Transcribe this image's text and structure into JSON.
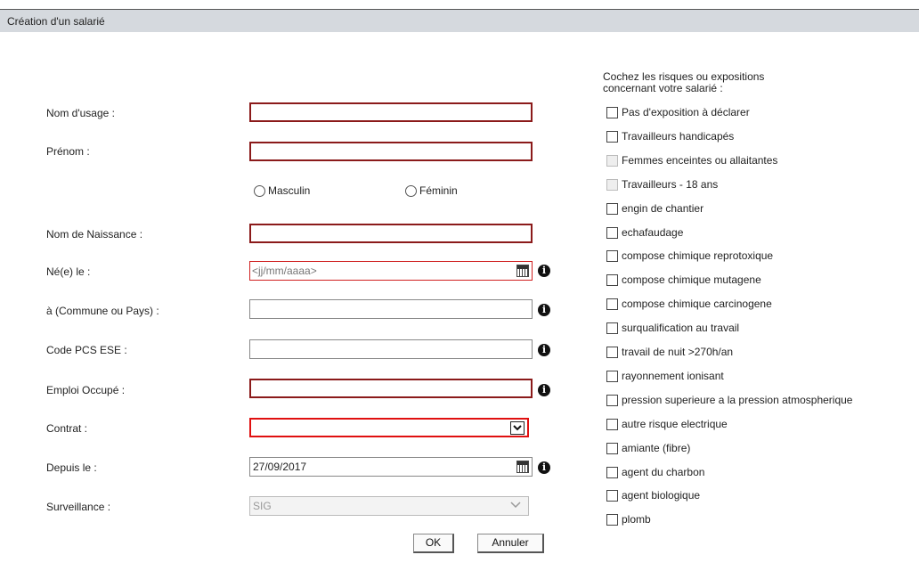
{
  "window": {
    "title": "Création d'un salarié"
  },
  "form": {
    "nom_usage": {
      "label": "Nom d'usage :",
      "value": ""
    },
    "prenom": {
      "label": "Prénom :",
      "value": ""
    },
    "sexe": {
      "options": [
        "Masculin",
        "Féminin"
      ],
      "selected": null
    },
    "nom_naissance": {
      "label": "Nom de Naissance :",
      "value": ""
    },
    "ne_le": {
      "label": "Né(e) le :",
      "placeholder": "<jj/mm/aaaa>"
    },
    "commune": {
      "label": "à (Commune ou Pays) :",
      "value": ""
    },
    "code_pcs": {
      "label": "Code PCS ESE :",
      "value": ""
    },
    "emploi": {
      "label": "Emploi Occupé :",
      "value": ""
    },
    "contrat": {
      "label": "Contrat :",
      "value": ""
    },
    "depuis": {
      "label": "Depuis le :",
      "value": "27/09/2017"
    },
    "surveillance": {
      "label": "Surveillance :",
      "value": "SIG"
    }
  },
  "risks": {
    "intro": "Cochez les risques ou expositions concernant votre salarié :",
    "items": [
      {
        "label": "Pas d'exposition à déclarer",
        "checked": false,
        "disabled": false
      },
      {
        "label": "Travailleurs handicapés",
        "checked": false,
        "disabled": false
      },
      {
        "label": "Femmes enceintes ou allaitantes",
        "checked": false,
        "disabled": true
      },
      {
        "label": "Travailleurs - 18 ans",
        "checked": false,
        "disabled": true
      },
      {
        "label": "engin de chantier",
        "checked": false,
        "disabled": false
      },
      {
        "label": "echafaudage",
        "checked": false,
        "disabled": false
      },
      {
        "label": "compose chimique reprotoxique",
        "checked": false,
        "disabled": false
      },
      {
        "label": "compose chimique mutagene",
        "checked": false,
        "disabled": false
      },
      {
        "label": "compose chimique carcinogene",
        "checked": false,
        "disabled": false
      },
      {
        "label": "surqualification au travail",
        "checked": false,
        "disabled": false
      },
      {
        "label": "travail de nuit >270h/an",
        "checked": false,
        "disabled": false
      },
      {
        "label": "rayonnement ionisant",
        "checked": false,
        "disabled": false
      },
      {
        "label": "pression superieure a la pression atmospherique",
        "checked": false,
        "disabled": false
      },
      {
        "label": "autre risque electrique",
        "checked": false,
        "disabled": false
      },
      {
        "label": "amiante (fibre)",
        "checked": false,
        "disabled": false
      },
      {
        "label": "agent du charbon",
        "checked": false,
        "disabled": false
      },
      {
        "label": "agent biologique",
        "checked": false,
        "disabled": false
      },
      {
        "label": "plomb",
        "checked": false,
        "disabled": false
      }
    ]
  },
  "buttons": {
    "ok": "OK",
    "cancel": "Annuler"
  },
  "colors": {
    "required_border": "#8b1a1a",
    "error_border": "#e01010",
    "titlebar": "#d5d9de"
  }
}
